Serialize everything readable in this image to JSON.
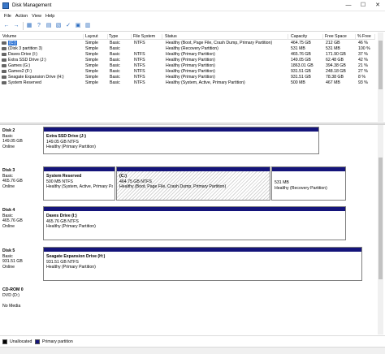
{
  "window": {
    "title": "Disk Management",
    "controls": [
      "—",
      "☐",
      "✕"
    ]
  },
  "menu": [
    "File",
    "Action",
    "View",
    "Help"
  ],
  "toolbar": [
    "←",
    "→",
    "▦",
    "?",
    "▤",
    "▧",
    "✓",
    "▣",
    "▥"
  ],
  "volume_table": {
    "headers": [
      "Volume",
      "Layout",
      "Type",
      "File System",
      "Status",
      "Capacity",
      "Free Space",
      "% Free"
    ],
    "rows": [
      [
        "(C:)",
        "Simple",
        "Basic",
        "NTFS",
        "Healthy (Boot, Page File, Crash Dump, Primary Partition)",
        "464.75 GB",
        "212 GB",
        "46 %"
      ],
      [
        "(Disk 3 partition 3)",
        "Simple",
        "Basic",
        "",
        "Healthy (Recovery Partition)",
        "531 MB",
        "531 MB",
        "100 %"
      ],
      [
        "Daves Drive (I:)",
        "Simple",
        "Basic",
        "NTFS",
        "Healthy (Primary Partition)",
        "465.76 GB",
        "171.90 GB",
        "37 %"
      ],
      [
        "Extra SSD Drive (J:)",
        "Simple",
        "Basic",
        "NTFS",
        "Healthy (Primary Partition)",
        "149.05 GB",
        "62.48 GB",
        "42 %"
      ],
      [
        "Games (G:)",
        "Simple",
        "Basic",
        "NTFS",
        "Healthy (Primary Partition)",
        "1863.01 GB",
        "394.38 GB",
        "21 %"
      ],
      [
        "Games2 (F:)",
        "Simple",
        "Basic",
        "NTFS",
        "Healthy (Primary Partition)",
        "931.51 GB",
        "248.18 GB",
        "27 %"
      ],
      [
        "Seagate Expansion Drive (H:)",
        "Simple",
        "Basic",
        "NTFS",
        "Healthy (Primary Partition)",
        "931.51 GB",
        "78.38 GB",
        "8 %"
      ],
      [
        "System Reserved",
        "Simple",
        "Basic",
        "NTFS",
        "Healthy (System, Active, Primary Partition)",
        "500 MB",
        "467 MB",
        "93 %"
      ]
    ],
    "selected_row": 0
  },
  "disks": [
    {
      "name": "Disk 2",
      "type": "Basic",
      "size": "149.05 GB",
      "state": "Online",
      "partitions": [
        {
          "name": "Extra SSD Drive (J:)",
          "size": "149.05 GB NTFS",
          "status": "Healthy (Primary Partition)"
        }
      ]
    },
    {
      "name": "Disk 3",
      "type": "Basic",
      "size": "465.76 GB",
      "state": "Online",
      "partitions": [
        {
          "name": "System Reserved",
          "size": "500 MB NTFS",
          "status": "Healthy (System, Active, Primary Partition)"
        },
        {
          "name": "(C:)",
          "size": "464.75 GB NTFS",
          "status": "Healthy (Boot, Page File, Crash Dump, Primary Partition)"
        },
        {
          "name": "",
          "size": "531 MB",
          "status": "Healthy (Recovery Partition)"
        }
      ]
    },
    {
      "name": "Disk 4",
      "type": "Basic",
      "size": "465.76 GB",
      "state": "Online",
      "partitions": [
        {
          "name": "Daves Drive (I:)",
          "size": "465.76 GB NTFS",
          "status": "Healthy (Primary Partition)"
        }
      ]
    },
    {
      "name": "Disk 5",
      "type": "Basic",
      "size": "931.51 GB",
      "state": "Online",
      "partitions": [
        {
          "name": "Seagate Expansion Drive (H:)",
          "size": "931.51 GB NTFS",
          "status": "Healthy (Primary Partition)"
        }
      ]
    },
    {
      "name": "CD-ROM 0",
      "type": "DVD (D:)",
      "size": "",
      "state": "No Media",
      "partitions": []
    }
  ],
  "legend": [
    {
      "label": "Unallocated",
      "color": "#000000"
    },
    {
      "label": "Primary partition",
      "color": "#14147a"
    }
  ],
  "colors": {
    "primary_bar": "#14147a",
    "selection": "#3478d6",
    "title_bar_bg": "#ffffff"
  }
}
